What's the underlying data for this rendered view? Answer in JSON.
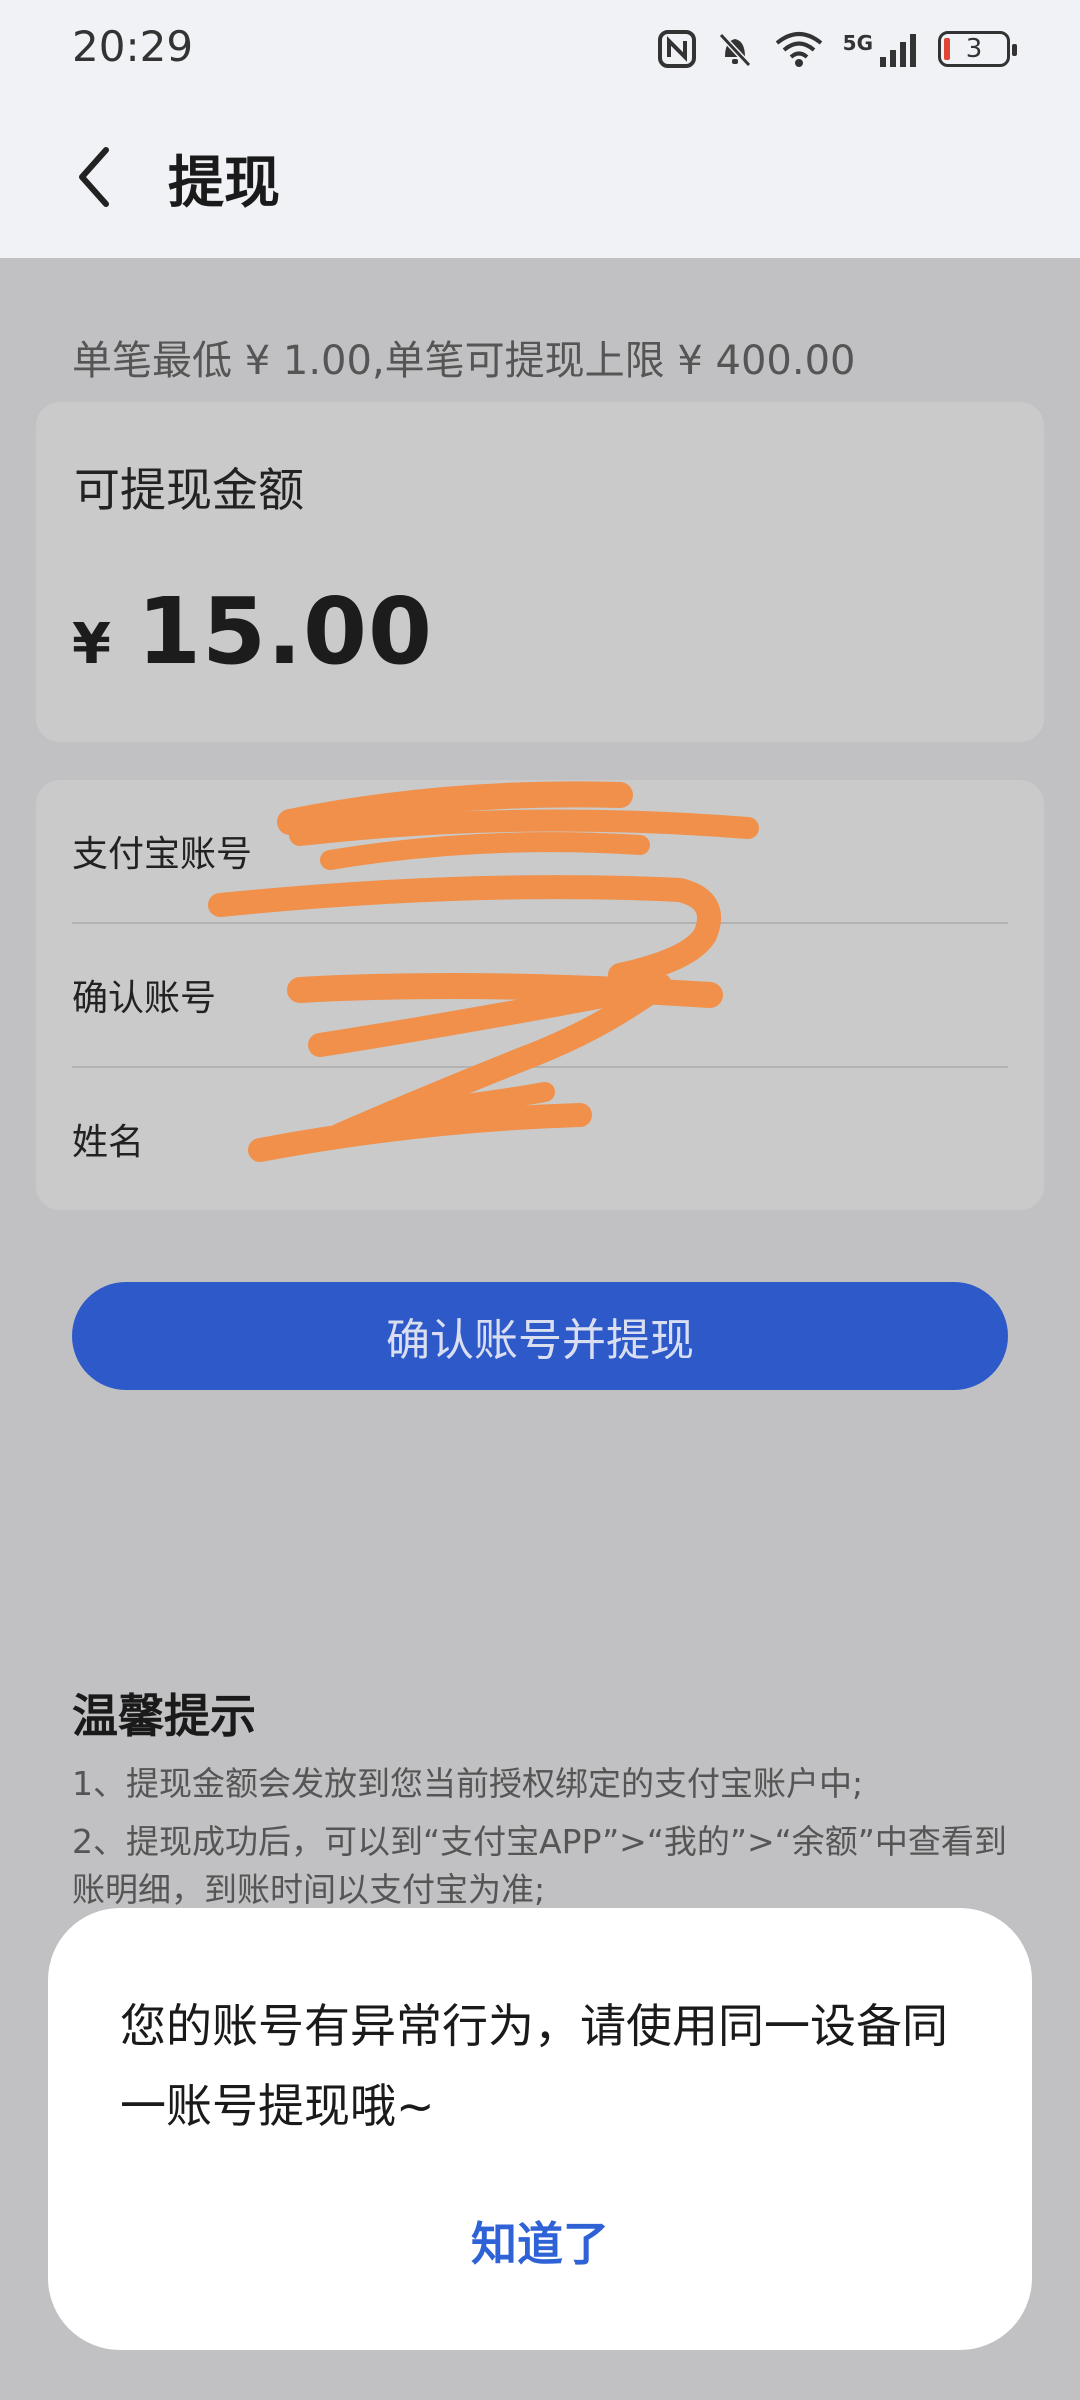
{
  "status": {
    "time": "20:29",
    "network": "5G",
    "battery": "3"
  },
  "header": {
    "title": "提现"
  },
  "limit_text": "单笔最低 ¥ 1.00,单笔可提现上限 ¥ 400.00",
  "balance": {
    "label": "可提现金额",
    "currency": "¥",
    "amount": "15.00"
  },
  "account": {
    "alipay_label": "支付宝账号",
    "alipay_value": "",
    "confirm_label": "确认账号",
    "confirm_value": "",
    "name_label": "姓名",
    "name_value": ""
  },
  "confirm_button": "确认账号并提现",
  "tips": {
    "title": "温馨提示",
    "items": [
      "1、提现金额会发放到您当前授权绑定的支付宝账户中;",
      "2、提现成功后，可以到“支付宝APP”>“我的”>“余额”中查看到账明细，到账时间以支付宝为准;"
    ]
  },
  "dialog": {
    "message": "您的账号有异常行为，请使用同一设备同一账号提现哦~",
    "button": "知道了"
  },
  "colors": {
    "primary": "#2e59c8",
    "dialog_button": "#2e62d6",
    "redaction": "#f0904a"
  }
}
